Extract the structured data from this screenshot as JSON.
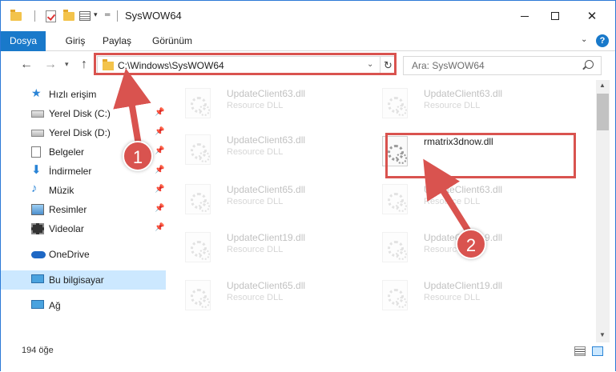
{
  "window": {
    "title": "SysWOW64"
  },
  "ribbon": {
    "tabs": [
      "Dosya",
      "Giriş",
      "Paylaş",
      "Görünüm"
    ]
  },
  "navigation": {
    "address": "C:\\Windows\\SysWOW64",
    "search_placeholder": "Ara: SysWOW64",
    "refresh_glyph": "↻"
  },
  "sidebar": {
    "items": [
      {
        "label": "Hızlı erişim",
        "icon": "star-icon",
        "pinned": false
      },
      {
        "label": "Yerel Disk (C:)",
        "icon": "drive-icon",
        "pinned": true
      },
      {
        "label": "Yerel Disk (D:)",
        "icon": "drive-icon",
        "pinned": true
      },
      {
        "label": "Belgeler",
        "icon": "documents-icon",
        "pinned": true
      },
      {
        "label": "İndirmeler",
        "icon": "download-icon",
        "pinned": true
      },
      {
        "label": "Müzik",
        "icon": "music-icon",
        "pinned": true
      },
      {
        "label": "Resimler",
        "icon": "pictures-icon",
        "pinned": true
      },
      {
        "label": "Videolar",
        "icon": "videos-icon",
        "pinned": true
      },
      {
        "label": "OneDrive",
        "icon": "onedrive-icon",
        "pinned": false
      },
      {
        "label": "Bu bilgisayar",
        "icon": "computer-icon",
        "pinned": false,
        "selected": true
      },
      {
        "label": "Ağ",
        "icon": "network-icon",
        "pinned": false
      }
    ]
  },
  "files": [
    {
      "name": "UpdateClient63.dll",
      "type": "Resource DLL",
      "faded": true
    },
    {
      "name": "UpdateClient63.dll",
      "type": "Resource DLL",
      "faded": true
    },
    {
      "name": "UpdateClient63.dll",
      "type": "Resource DLL",
      "faded": true
    },
    {
      "name": "rmatrix3dnow.dll",
      "type": "",
      "faded": false
    },
    {
      "name": "UpdateClient65.dll",
      "type": "Resource DLL",
      "faded": true
    },
    {
      "name": "UpdateClient63.dll",
      "type": "Resource DLL",
      "faded": true
    },
    {
      "name": "UpdateClient19.dll",
      "type": "Resource DLL",
      "faded": true
    },
    {
      "name": "UpdateClient19.dll",
      "type": "Resource DLL",
      "faded": true
    },
    {
      "name": "UpdateClient65.dll",
      "type": "Resource DLL",
      "faded": true
    },
    {
      "name": "UpdateClient19.dll",
      "type": "Resource DLL",
      "faded": true
    }
  ],
  "status": {
    "item_count": "194 öğe"
  },
  "annotations": {
    "step1": "1",
    "step2": "2",
    "color": "#d9534f"
  }
}
